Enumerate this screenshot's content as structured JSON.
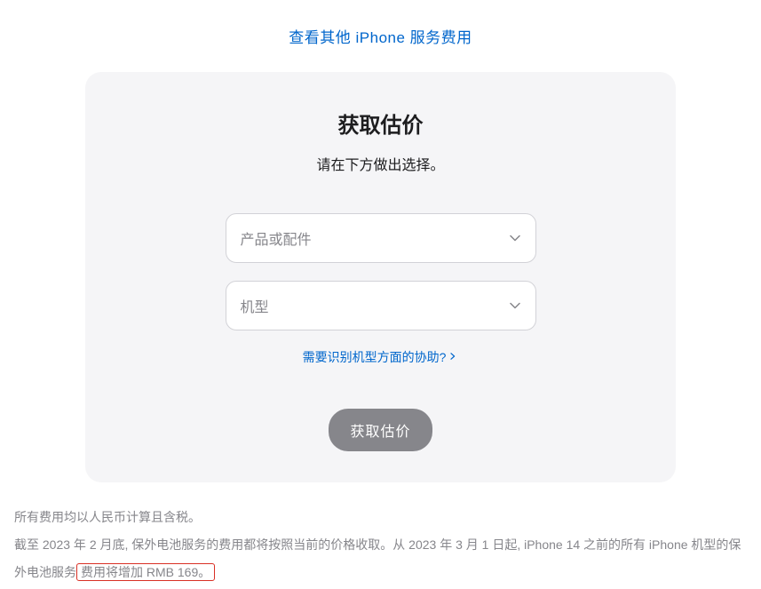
{
  "topLink": {
    "label": "查看其他 iPhone 服务费用"
  },
  "card": {
    "title": "获取估价",
    "subtitle": "请在下方做出选择。",
    "productSelect": {
      "placeholder": "产品或配件"
    },
    "modelSelect": {
      "placeholder": "机型"
    },
    "helpLink": {
      "label": "需要识别机型方面的协助?"
    },
    "submitButton": {
      "label": "获取估价"
    }
  },
  "footer": {
    "line1": "所有费用均以人民币计算且含税。",
    "line2_part1": "截至 2023 年 2 月底, 保外电池服务的费用都将按照当前的价格收取。从 2023 年 3 月 1 日起, iPhone 14 之前的所有 iPhone 机型的保外电池服务",
    "line2_highlight": "费用将增加 RMB 169。"
  }
}
